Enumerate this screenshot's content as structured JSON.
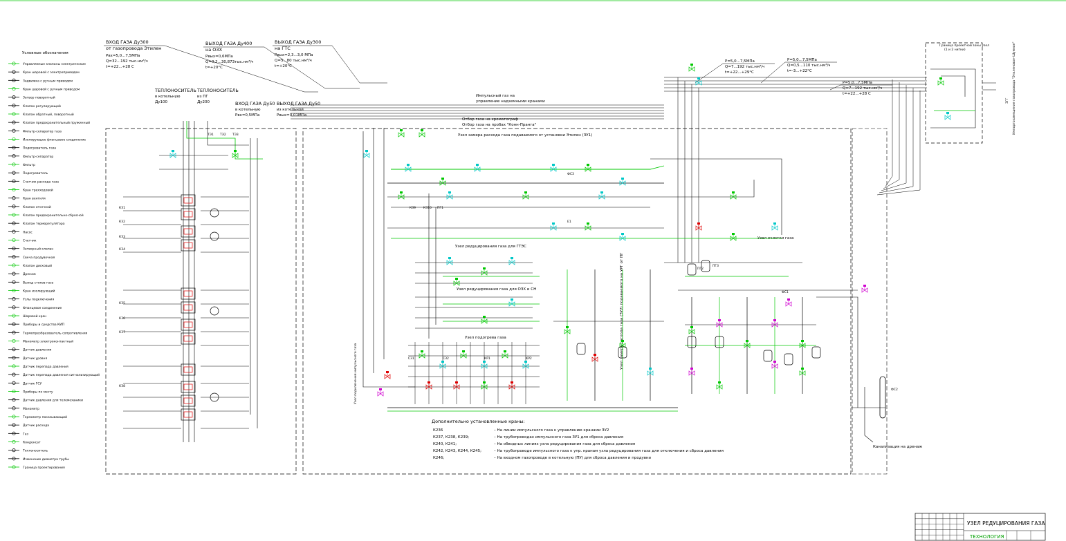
{
  "colors": {
    "background": "#ffffff",
    "line": "#000000",
    "pipe_green": "#00c800",
    "valve_cyan": "#00c8c8",
    "valve_magenta": "#d000d0",
    "valve_red": "#e00000",
    "title_green": "#00a000"
  },
  "legend": {
    "title": "Условные обозначения",
    "items": [
      "Управляемые клапаны электрические",
      "Кран шаровой с электроприводом",
      "Задвижка с ручным приводом",
      "Кран шаровой с ручным приводом",
      "Затвор поворотный",
      "Клапан регулирующий",
      "Клапан обратный, поворотный",
      "Клапан предохранительный пружинный",
      "Фильтр-сепаратор газа",
      "Изолирующее фланцевое соединение",
      "Подогреватель газа",
      "Фильтр-сепаратор",
      "Фильтр",
      "Подогреватель",
      "Счетчик расхода газа",
      "Кран трехходовой",
      "Кран вентиля",
      "Клапан отсечной",
      "Клапан предохранительно-сбросной",
      "Клапан терморегулятора",
      "Насос",
      "Счетчик",
      "Затворный клапан",
      "Свеча продувочная",
      "Клапан дисковый",
      "Дренаж",
      "Выход стоков газа",
      "Кран изолирующий",
      "Узлы подключения",
      "Фланцевое соединение",
      "Шаровой кран",
      "Приборы и средства КИП",
      "Термопреобразователь сопротивления",
      "Манометр электроконтактный",
      "Датчик давления",
      "Датчик уровня",
      "Датчик перепада давления",
      "Датчик перепада давления сигнализирующий",
      "Датчик ГСУ",
      "Приборы по месту",
      "Датчик давления для телемеханики",
      "Манометр",
      "Термометр показывающий",
      "Датчик расхода",
      "Газ",
      "Конденсат",
      "Теплоноситель",
      "Изменение диаметра трубы",
      "Граница проектирования"
    ]
  },
  "inputs": {
    "gas_in_main": {
      "title": "ВХОД ГАЗА Ду300",
      "sub": "от газопровода Этилен",
      "p": "Pвх=5,0...7,5МПа",
      "q": "Q=32...192 тыс.нм³/ч",
      "t": "t=+22...+28 С"
    },
    "gas_out_gsx": {
      "title": "ВЫХОД ГАЗА Ду400",
      "sub": "на ОЗХ",
      "p": "Pвых=0,6МПа",
      "q": "Q=0,2...30,873тыс.нм³/ч",
      "t": "t=+20°С"
    },
    "gas_out_gts": {
      "title": "ВЫХОД ГАЗА Ду300",
      "sub": "на ГТС",
      "p": "Pвых=2,3...3,0 МПа",
      "q": "Q=5...80 тыс.нм³/ч",
      "t": "t=+20°С"
    },
    "heat_carrier_boiler": {
      "title": "ТЕПЛОНОСИТЕЛЬ",
      "sub": "в котельную",
      "dn": "Ду100"
    },
    "heat_carrier_pg": {
      "title": "ТЕПЛОНОСИТЕЛЬ",
      "sub": "из ПГ",
      "dn": "Ду200"
    },
    "gas_in_boiler": {
      "title": "ВХОД ГАЗА Ду50",
      "sub": "в котельную",
      "p": "Pвх=0,5МПа"
    },
    "gas_out_boiler": {
      "title": "ВЫХОД ГАЗА Ду50",
      "sub": "из котельной",
      "p": "Pвых=0,01МПа"
    },
    "right_1": {
      "p": "P=5,0...7,5МПа",
      "q": "Q=7...192 тыс.нм³/ч",
      "t": "t=+22...+29°С"
    },
    "right_2": {
      "p": "P=5,0...7,5МПа",
      "q": "Q=0,5...110 тыс.нм³/ч",
      "t": "t=-3...+22°С"
    },
    "right_3": {
      "p": "P=5,0...7,5МПа",
      "q": "Q=7...192 тыс.нм³/ч",
      "t": "t=+22...+28 С"
    }
  },
  "notes": {
    "impulse_gas": "Импульсный газ на",
    "impulse_gas2": "управление надземными кранами",
    "chromatograph": "Отбор газа на хроматограф",
    "sampling": "Отбор газа на пробах \"Конн-Пранга\"",
    "drain_to_tank": "Канализация на дренаж"
  },
  "sections": {
    "metering": "Узел замера расхода газа подаваемого от установки Этилен (ЗУ1)",
    "reduction_gts": "Узел редуцирования газа для ГТЭС",
    "reduction_gsx": "Узел редуцирования газа для ОЗХ и СН",
    "heating": "Узел подогрева газа",
    "cleaning": "Узел очистки газа",
    "metering_nf": "Узел замера расхода газа (ЗУ2) подаваемого на УРГ от ПГ",
    "vertical_left": "Узел подключения импульсного газа",
    "right_box_title": "Граница проектной зоны узел",
    "right_box_sub": "(1 и 2 нитки)"
  },
  "equipment_labels": [
    "ТЭ1",
    "ТЭ2",
    "ТЭ3",
    "КЗ1",
    "КЗ2",
    "КЗ3",
    "КЗ4",
    "КЗ5",
    "КЗ6",
    "КЗ7",
    "КЗ8",
    "КЗ9",
    "КЗ10",
    "ПГ1",
    "ПГ2",
    "ПГ3",
    "ФС1",
    "ФС2",
    "ФС3",
    "Е1",
    "СЗ1",
    "СЗ2",
    "КР1",
    "КР2"
  ],
  "additional_valves": {
    "title": "Дополнительно установленные краны:",
    "rows": [
      {
        "tag": "К236",
        "desc": "– На линии импульсного газа к управлению кранами ЗУ2"
      },
      {
        "tag": "К237, К238, К239;",
        "desc": "– На трубопроводах импульсного газа ЗУ1 для сброса давления"
      },
      {
        "tag": "К240, К241;",
        "desc": "– На обводных линиях узла редуцирования газа для сброса давления"
      },
      {
        "tag": "К242, К243, К244, К245;",
        "desc": "– На трубопроводе импульсного газа к упр. кранам узла редуцирования газа для отключения и сброса давления"
      },
      {
        "tag": "К246;",
        "desc": "– На входном газопроводе в котельную (ПУ) для сброса давления и продувки"
      }
    ]
  },
  "vertical_right_label": "Импортозамещение газопровода \"Этиленовое–Шумное\"",
  "vertical_right_short": "ЗГГ",
  "title_block": {
    "title": "УЗЕЛ РЕДУЦИРОВАНИЯ ГАЗА",
    "subtitle": "ТЕХНОЛОГИЯ"
  }
}
